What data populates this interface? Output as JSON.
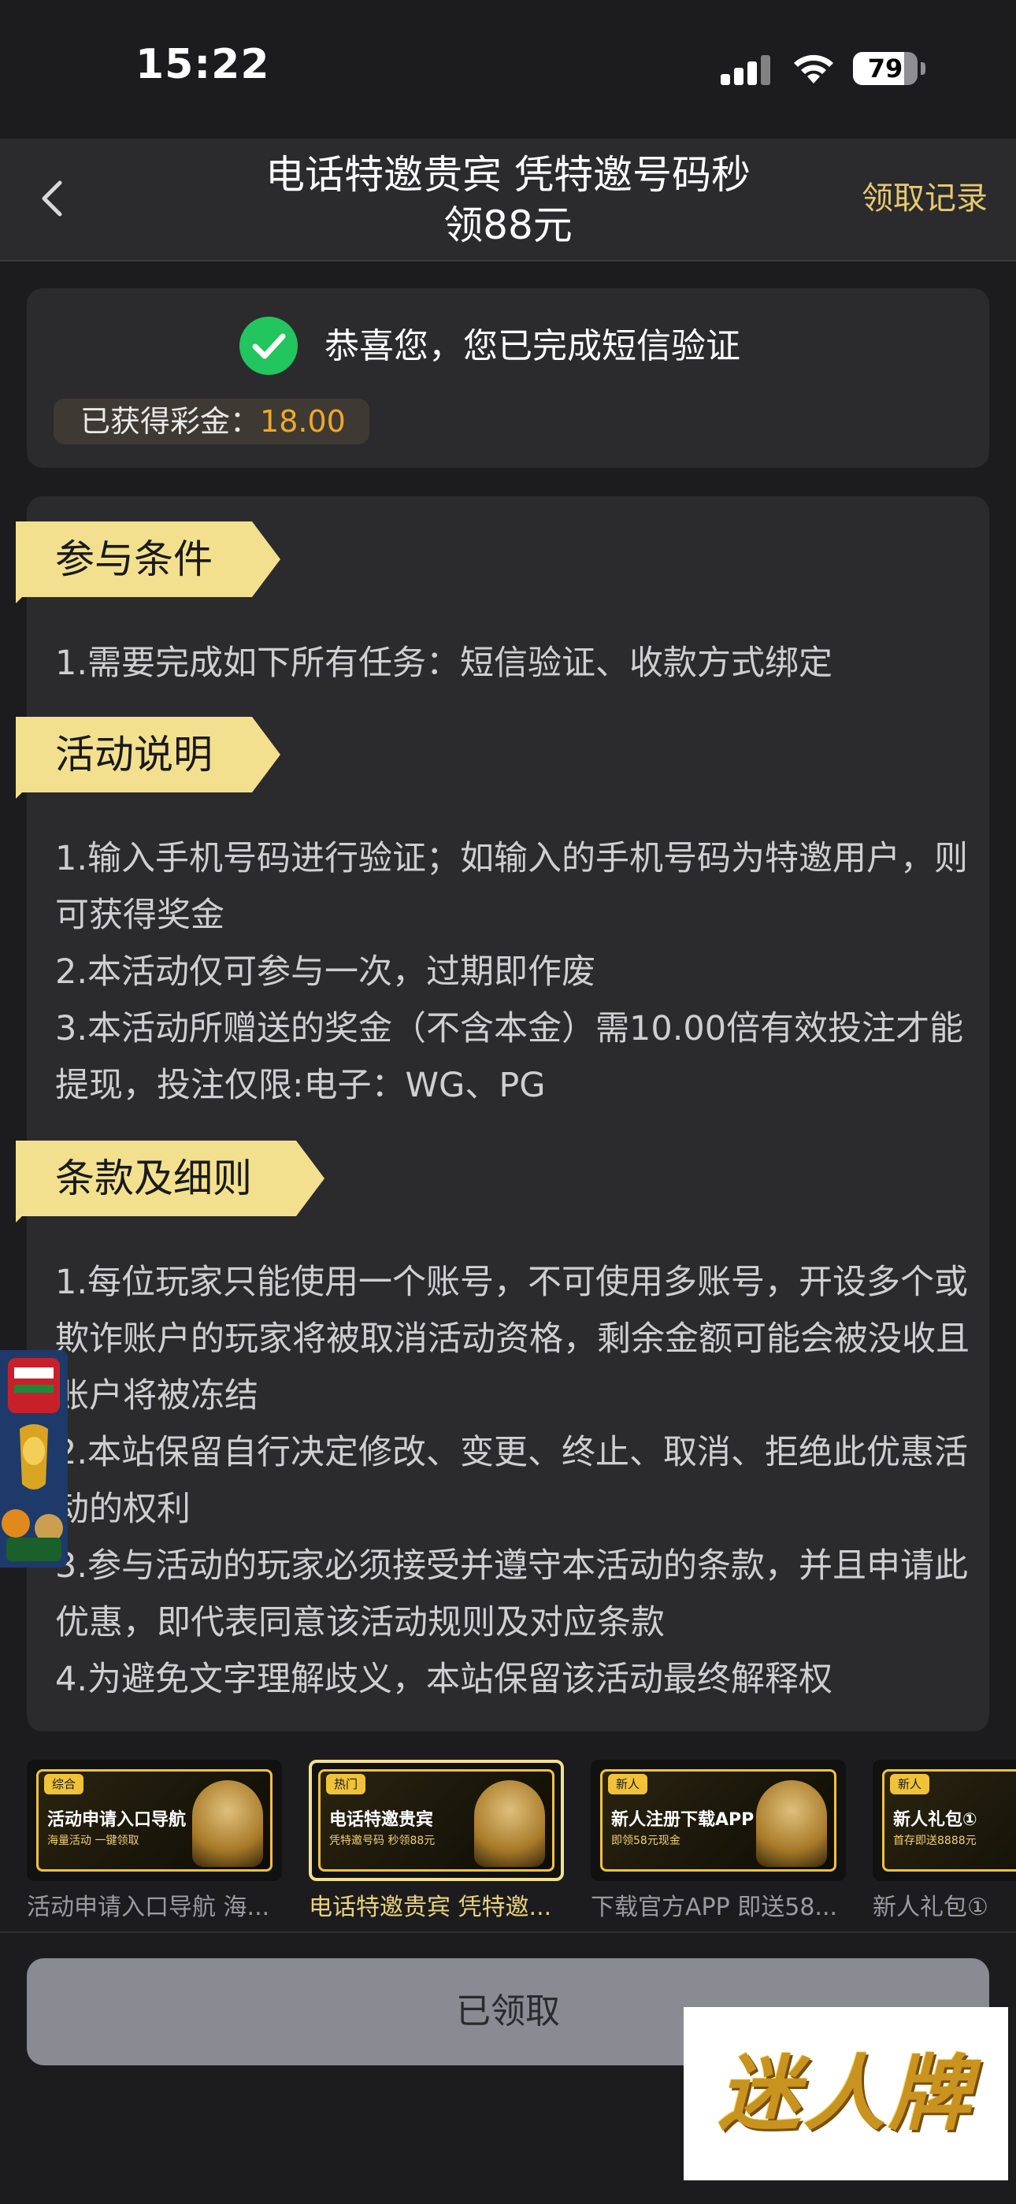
{
  "status_bar": {
    "time": "15:22",
    "battery": "79",
    "battery_level": 0.79
  },
  "nav": {
    "title_line1": "电话特邀贵宾 凭特邀号码秒",
    "title_line2": "领88元",
    "right_link": "领取记录"
  },
  "success": {
    "message": "恭喜您，您已完成短信验证",
    "prize_label": "已获得彩金：",
    "prize_value": "18.00"
  },
  "sections": [
    {
      "title": "参与条件",
      "paragraphs": [
        "1.需要完成如下所有任务：短信验证、收款方式绑定"
      ]
    },
    {
      "title": "活动说明",
      "paragraphs": [
        "1.输入手机号码进行验证；如输入的手机号码为特邀用户，则可获得奖金",
        "2.本活动仅可参与一次，过期即作废",
        "3.本活动所赠送的奖金（不含本金）需10.00倍有效投注才能提现，投注仅限:电子：WG、PG"
      ]
    },
    {
      "title": "条款及细则",
      "paragraphs": [
        "1.每位玩家只能使用一个账号，不可使用多账号，开设多个或欺诈账户的玩家将被取消活动资格，剩余金额可能会被没收且账户将被冻结",
        "2.本站保留自行决定修改、变更、终止、取消、拒绝此优惠活动的权利",
        "3.参与活动的玩家必须接受并遵守本活动的条款，并且申请此优惠，即代表同意该活动规则及对应条款",
        "4.为避免文字理解歧义，本站保留该活动最终解释权"
      ]
    }
  ],
  "promos": [
    {
      "tag": "综合",
      "headline": "活动申请入口导航",
      "sub": "海量活动 一键领取",
      "caption": "活动申请入口导航 海...",
      "active": false
    },
    {
      "tag": "热门",
      "headline": "电话特邀贵宾",
      "sub": "凭特邀号码 秒领88元",
      "caption": "电话特邀贵宾 凭特邀...",
      "active": true
    },
    {
      "tag": "新人",
      "headline": "新人注册下载APP",
      "sub": "即领58元现金",
      "caption": "下载官方APP 即送58...",
      "active": false
    },
    {
      "tag": "新人",
      "headline": "新人礼包①",
      "sub": "首存即送8888元",
      "caption": "新人礼包①",
      "active": false
    }
  ],
  "claim_button": "已领取",
  "watermark": "迷人牌",
  "colors": {
    "accent_gold": "#e6c86e",
    "prize_orange": "#f0a82a",
    "tag_yellow": "#f2e08f",
    "success_green": "#22c55e"
  }
}
